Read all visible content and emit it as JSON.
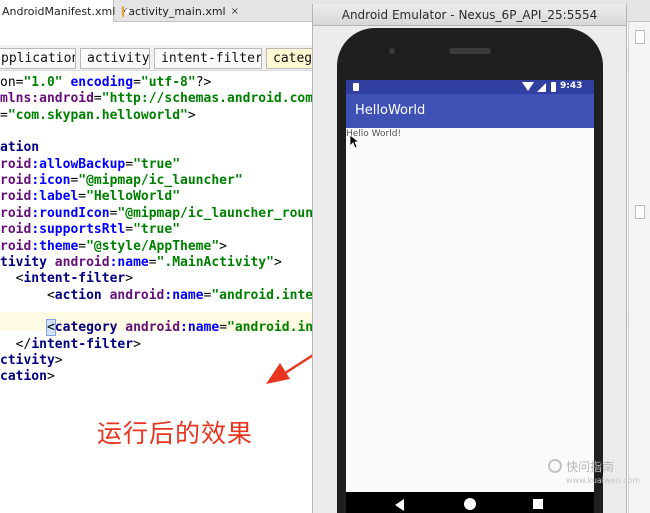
{
  "ide": {
    "tabs": [
      {
        "label": "AndroidManifest.xml",
        "close": "×"
      },
      {
        "label": "activity_main.xml",
        "close": "×"
      }
    ],
    "breadcrumbs": [
      "pplication",
      "activity",
      "intent-filter",
      "catego"
    ],
    "code_lines": [
      [
        {
          "t": "plain",
          "v": "on="
        },
        {
          "t": "val",
          "v": "\"1.0\""
        },
        {
          "t": "plain",
          "v": " "
        },
        {
          "t": "attr",
          "v": "encoding"
        },
        {
          "t": "plain",
          "v": "="
        },
        {
          "t": "val",
          "v": "\"utf-8\""
        },
        {
          "t": "plain",
          "v": "?>"
        }
      ],
      [
        {
          "t": "ns",
          "v": "mlns:android"
        },
        {
          "t": "plain",
          "v": "="
        },
        {
          "t": "val",
          "v": "\"http://schemas.android.com/"
        }
      ],
      [
        {
          "t": "plain",
          "v": "="
        },
        {
          "t": "val",
          "v": "\"com.skypan.helloworld\""
        },
        {
          "t": "plain",
          "v": ">"
        }
      ],
      [],
      [
        {
          "t": "tag",
          "v": "ation"
        }
      ],
      [
        {
          "t": "ns",
          "v": "roid"
        },
        {
          "t": "attr",
          "v": ":allowBackup"
        },
        {
          "t": "plain",
          "v": "="
        },
        {
          "t": "val",
          "v": "\"true\""
        }
      ],
      [
        {
          "t": "ns",
          "v": "roid"
        },
        {
          "t": "attr",
          "v": ":icon"
        },
        {
          "t": "plain",
          "v": "="
        },
        {
          "t": "val",
          "v": "\"@mipmap/ic_launcher\""
        }
      ],
      [
        {
          "t": "ns",
          "v": "roid"
        },
        {
          "t": "attr",
          "v": ":label"
        },
        {
          "t": "plain",
          "v": "="
        },
        {
          "t": "val",
          "v": "\"HelloWorld\""
        }
      ],
      [
        {
          "t": "ns",
          "v": "roid"
        },
        {
          "t": "attr",
          "v": ":roundIcon"
        },
        {
          "t": "plain",
          "v": "="
        },
        {
          "t": "val",
          "v": "\"@mipmap/ic_launcher_round"
        }
      ],
      [
        {
          "t": "ns",
          "v": "roid"
        },
        {
          "t": "attr",
          "v": ":supportsRtl"
        },
        {
          "t": "plain",
          "v": "="
        },
        {
          "t": "val",
          "v": "\"true\""
        }
      ],
      [
        {
          "t": "ns",
          "v": "roid"
        },
        {
          "t": "attr",
          "v": ":theme"
        },
        {
          "t": "plain",
          "v": "="
        },
        {
          "t": "val",
          "v": "\"@style/AppTheme\""
        },
        {
          "t": "plain",
          "v": ">"
        }
      ],
      [
        {
          "t": "tag",
          "v": "tivity "
        },
        {
          "t": "ns",
          "v": "android"
        },
        {
          "t": "attr",
          "v": ":name"
        },
        {
          "t": "plain",
          "v": "="
        },
        {
          "t": "val",
          "v": "\".MainActivity\""
        },
        {
          "t": "plain",
          "v": ">"
        }
      ],
      [
        {
          "t": "plain",
          "v": "  <"
        },
        {
          "t": "tag",
          "v": "intent-filter"
        },
        {
          "t": "plain",
          "v": ">"
        }
      ],
      [
        {
          "t": "plain",
          "v": "      <"
        },
        {
          "t": "tag",
          "v": "action "
        },
        {
          "t": "ns",
          "v": "android"
        },
        {
          "t": "attr",
          "v": ":name"
        },
        {
          "t": "plain",
          "v": "="
        },
        {
          "t": "val",
          "v": "\"android.intent"
        }
      ],
      [],
      [
        {
          "t": "plain",
          "v": "      "
        },
        {
          "t": "sel",
          "v": "<"
        },
        {
          "t": "tag",
          "v": "category "
        },
        {
          "t": "ns",
          "v": "android"
        },
        {
          "t": "attr",
          "v": ":name"
        },
        {
          "t": "plain",
          "v": "="
        },
        {
          "t": "val",
          "v": "\"android.inte"
        }
      ],
      [
        {
          "t": "plain",
          "v": "  </"
        },
        {
          "t": "tag",
          "v": "intent-filter"
        },
        {
          "t": "plain",
          "v": ">"
        }
      ],
      [
        {
          "t": "tag",
          "v": "ctivity"
        },
        {
          "t": "plain",
          "v": ">"
        }
      ],
      [
        {
          "t": "tag",
          "v": "cation"
        },
        {
          "t": "plain",
          "v": ">"
        }
      ]
    ],
    "annotation_text": "运行后的效果",
    "annotation_color": "#e8351f"
  },
  "emulator": {
    "title": "Android Emulator - Nexus_6P_API_25:5554",
    "status_time": "9:43",
    "app_title": "HelloWorld",
    "content_text": "Hello World!",
    "colors": {
      "status_bar": "#303f9f",
      "app_bar": "#3f51b5"
    },
    "icons": [
      "sd-card-icon",
      "wifi-icon",
      "signal-icon",
      "battery-icon",
      "back-icon",
      "home-icon",
      "recents-icon"
    ]
  },
  "watermark": {
    "text": "快问指南",
    "sub": "www.kuaiwen.com"
  }
}
